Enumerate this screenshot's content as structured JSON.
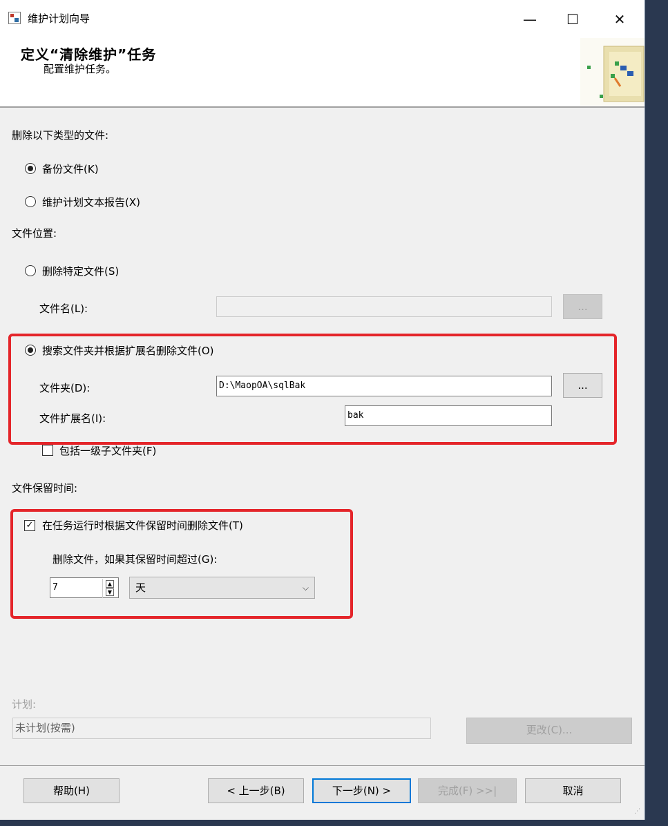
{
  "window": {
    "title": "维护计划向导",
    "minimize": "—",
    "maximize": "☐",
    "close": "✕"
  },
  "header": {
    "title": "定义“清除维护”任务",
    "subtitle": "配置维护任务。"
  },
  "delete_type": {
    "label": "删除以下类型的文件:",
    "options": [
      {
        "label": "备份文件(K)",
        "selected": true
      },
      {
        "label": "维护计划文本报告(X)",
        "selected": false
      }
    ]
  },
  "location": {
    "label": "文件位置:",
    "specific": {
      "label": "删除特定文件(S)",
      "selected": false,
      "filename_label": "文件名(L):",
      "filename_value": "",
      "browse": "..."
    },
    "search": {
      "label": "搜索文件夹并根据扩展名删除文件(O)",
      "selected": true,
      "folder_label": "文件夹(D):",
      "folder_value": "D:\\MaopOA\\sqlBak",
      "browse": "...",
      "ext_label": "文件扩展名(I):",
      "ext_value": "bak",
      "subfolder_label": "包括一级子文件夹(F)",
      "subfolder_checked": false
    }
  },
  "retention": {
    "label": "文件保留时间:",
    "enable_label": "在任务运行时根据文件保留时间删除文件(T)",
    "enable_checked": true,
    "older_label": "删除文件，如果其保留时间超过(G):",
    "value": "7",
    "unit": "天"
  },
  "schedule": {
    "label": "计划:",
    "value": "未计划(按需)",
    "change": "更改(C)..."
  },
  "buttons": {
    "help": "帮助(H)",
    "back": "< 上一步(B)",
    "next": "下一步(N) >",
    "finish": "完成(F) >>|",
    "cancel": "取消"
  }
}
